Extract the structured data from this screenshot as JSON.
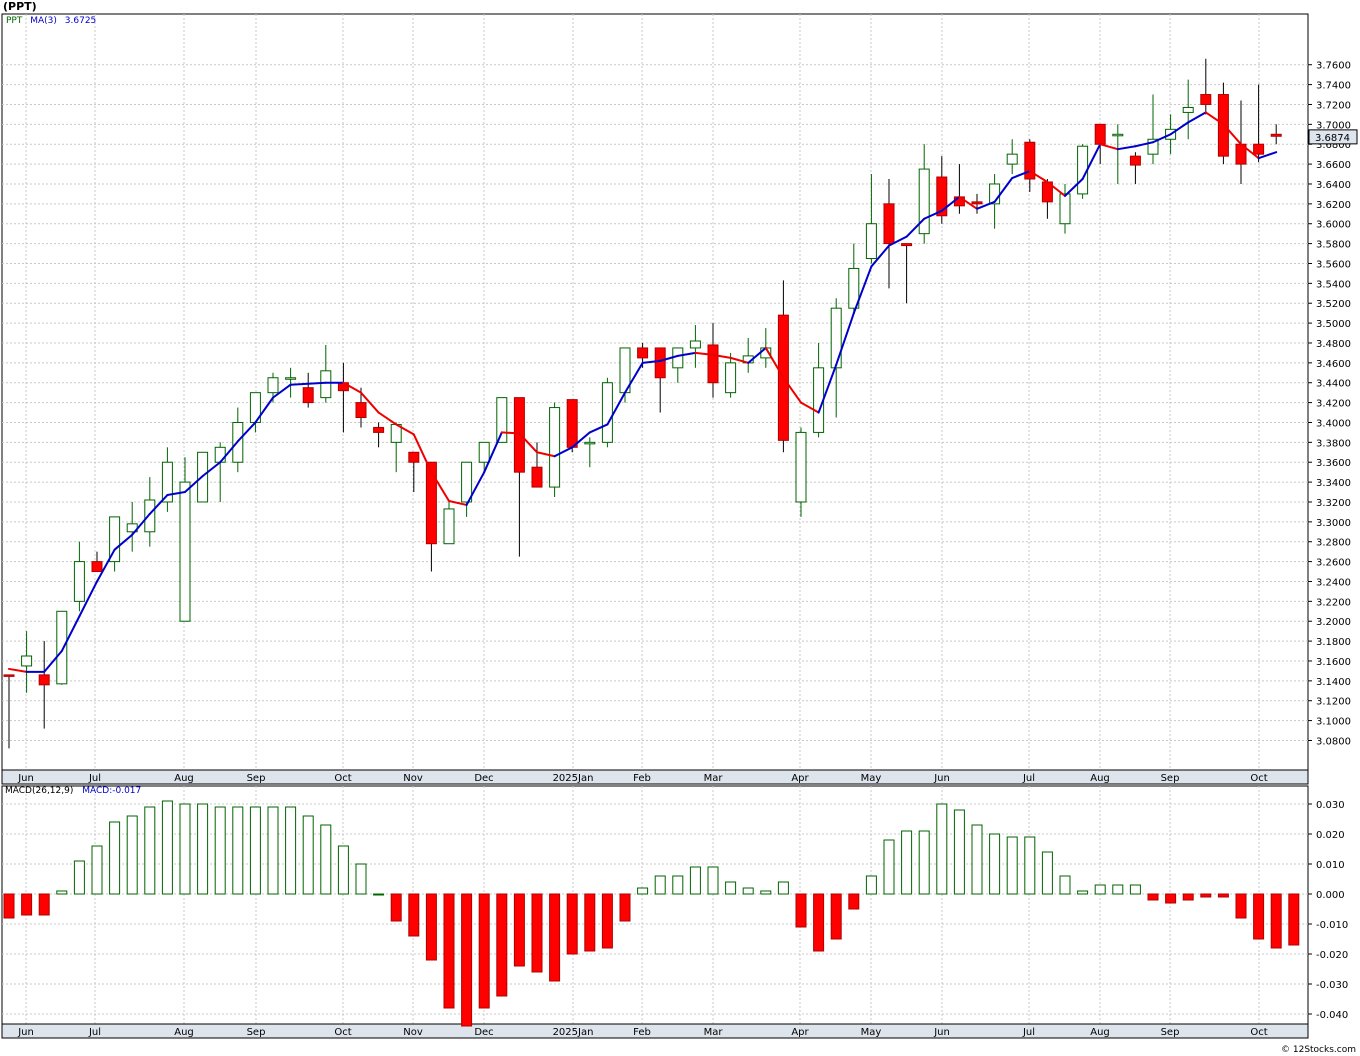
{
  "title": "(PPT)",
  "legend": {
    "symbol": "PPT",
    "ma_label": "MA(3)",
    "ma_value": "3.6725",
    "macd_label": "MACD(26,12,9)",
    "macd_value": "MACD:-0.017"
  },
  "last_price_label": "3.6874",
  "credit": "© 12Stocks.com",
  "colors": {
    "up": "#006400",
    "down": "#ff0000",
    "ma_up": "#0000cc",
    "ma_down": "#ee0000",
    "grid": "#c8c8c8",
    "axis_band": "#dde4ec"
  },
  "chart_data": [
    {
      "type": "candlestick",
      "title": "(PPT)",
      "x_labels": [
        "Jun",
        "Jul",
        "Aug",
        "Sep",
        "Oct",
        "Nov",
        "Dec",
        "2025Jan",
        "Feb",
        "Mar",
        "Apr",
        "May",
        "Jun",
        "Jul",
        "Aug",
        "Sep",
        "Oct"
      ],
      "y_ticks": [
        "3.0800",
        "3.1000",
        "3.1200",
        "3.1400",
        "3.1600",
        "3.1800",
        "3.2000",
        "3.2200",
        "3.2400",
        "3.2600",
        "3.2800",
        "3.3000",
        "3.3200",
        "3.3400",
        "3.3600",
        "3.3800",
        "3.4000",
        "3.4200",
        "3.4400",
        "3.4600",
        "3.4800",
        "3.5000",
        "3.5200",
        "3.5400",
        "3.5600",
        "3.5800",
        "3.6000",
        "3.6200",
        "3.6400",
        "3.6600",
        "3.6800",
        "3.7000",
        "3.7200",
        "3.7400",
        "3.7600"
      ],
      "ylim": [
        3.072,
        3.78
      ],
      "ohlc": [
        [
          3.146,
          3.146,
          3.072,
          3.145
        ],
        [
          3.155,
          3.19,
          3.128,
          3.165
        ],
        [
          3.146,
          3.18,
          3.092,
          3.136
        ],
        [
          3.137,
          3.21,
          3.136,
          3.21
        ],
        [
          3.22,
          3.28,
          3.21,
          3.26
        ],
        [
          3.26,
          3.27,
          3.25,
          3.25
        ],
        [
          3.26,
          3.305,
          3.25,
          3.305
        ],
        [
          3.29,
          3.32,
          3.27,
          3.298
        ],
        [
          3.29,
          3.345,
          3.275,
          3.322
        ],
        [
          3.32,
          3.375,
          3.31,
          3.36
        ],
        [
          3.2,
          3.365,
          3.2,
          3.34
        ],
        [
          3.32,
          3.37,
          3.32,
          3.37
        ],
        [
          3.36,
          3.38,
          3.32,
          3.375
        ],
        [
          3.36,
          3.415,
          3.35,
          3.4
        ],
        [
          3.4,
          3.43,
          3.39,
          3.43
        ],
        [
          3.43,
          3.45,
          3.42,
          3.445
        ],
        [
          3.445,
          3.455,
          3.425,
          3.445
        ],
        [
          3.435,
          3.45,
          3.415,
          3.42
        ],
        [
          3.425,
          3.478,
          3.42,
          3.452
        ],
        [
          3.44,
          3.46,
          3.39,
          3.432
        ],
        [
          3.42,
          3.435,
          3.395,
          3.405
        ],
        [
          3.395,
          3.4,
          3.375,
          3.39
        ],
        [
          3.38,
          3.4,
          3.35,
          3.398
        ],
        [
          3.37,
          3.37,
          3.33,
          3.36
        ],
        [
          3.36,
          3.36,
          3.25,
          3.278
        ],
        [
          3.278,
          3.32,
          3.278,
          3.313
        ],
        [
          3.32,
          3.36,
          3.305,
          3.36
        ],
        [
          3.36,
          3.38,
          3.35,
          3.38
        ],
        [
          3.38,
          3.425,
          3.38,
          3.425
        ],
        [
          3.425,
          3.425,
          3.265,
          3.35
        ],
        [
          3.355,
          3.38,
          3.335,
          3.335
        ],
        [
          3.335,
          3.42,
          3.325,
          3.415
        ],
        [
          3.423,
          3.423,
          3.37,
          3.375
        ],
        [
          3.38,
          3.385,
          3.355,
          3.38
        ],
        [
          3.38,
          3.445,
          3.375,
          3.44
        ],
        [
          3.43,
          3.475,
          3.42,
          3.475
        ],
        [
          3.475,
          3.48,
          3.455,
          3.465
        ],
        [
          3.475,
          3.475,
          3.41,
          3.445
        ],
        [
          3.455,
          3.475,
          3.44,
          3.475
        ],
        [
          3.475,
          3.498,
          3.455,
          3.482
        ],
        [
          3.478,
          3.5,
          3.425,
          3.44
        ],
        [
          3.43,
          3.47,
          3.425,
          3.46
        ],
        [
          3.46,
          3.485,
          3.45,
          3.467
        ],
        [
          3.465,
          3.495,
          3.455,
          3.475
        ],
        [
          3.508,
          3.543,
          3.37,
          3.382
        ],
        [
          3.32,
          3.395,
          3.305,
          3.39
        ],
        [
          3.39,
          3.48,
          3.385,
          3.455
        ],
        [
          3.455,
          3.525,
          3.405,
          3.515
        ],
        [
          3.515,
          3.58,
          3.51,
          3.555
        ],
        [
          3.565,
          3.65,
          3.56,
          3.6
        ],
        [
          3.62,
          3.645,
          3.535,
          3.58
        ],
        [
          3.58,
          3.58,
          3.52,
          3.578
        ],
        [
          3.59,
          3.68,
          3.58,
          3.655
        ],
        [
          3.647,
          3.668,
          3.6,
          3.608
        ],
        [
          3.627,
          3.66,
          3.61,
          3.618
        ],
        [
          3.622,
          3.63,
          3.61,
          3.62
        ],
        [
          3.62,
          3.65,
          3.595,
          3.64
        ],
        [
          3.66,
          3.685,
          3.65,
          3.67
        ],
        [
          3.682,
          3.685,
          3.632,
          3.645
        ],
        [
          3.642,
          3.645,
          3.605,
          3.622
        ],
        [
          3.6,
          3.64,
          3.59,
          3.63
        ],
        [
          3.63,
          3.68,
          3.625,
          3.678
        ],
        [
          3.7,
          3.7,
          3.66,
          3.68
        ],
        [
          3.69,
          3.7,
          3.64,
          3.69
        ],
        [
          3.668,
          3.672,
          3.64,
          3.659
        ],
        [
          3.67,
          3.73,
          3.66,
          3.685
        ],
        [
          3.685,
          3.71,
          3.67,
          3.695
        ],
        [
          3.712,
          3.745,
          3.685,
          3.717
        ],
        [
          3.73,
          3.766,
          3.71,
          3.72
        ],
        [
          3.73,
          3.742,
          3.66,
          3.668
        ],
        [
          3.68,
          3.724,
          3.64,
          3.66
        ],
        [
          3.68,
          3.74,
          3.662,
          3.67
        ],
        [
          3.69,
          3.7,
          3.68,
          3.688
        ]
      ],
      "ma": [
        3.152,
        3.149,
        3.149,
        3.17,
        3.205,
        3.24,
        3.272,
        3.287,
        3.308,
        3.327,
        3.33,
        3.346,
        3.36,
        3.381,
        3.4,
        3.425,
        3.438,
        3.439,
        3.44,
        3.44,
        3.43,
        3.41,
        3.398,
        3.388,
        3.35,
        3.321,
        3.317,
        3.35,
        3.39,
        3.389,
        3.37,
        3.366,
        3.375,
        3.39,
        3.398,
        3.43,
        3.46,
        3.462,
        3.467,
        3.47,
        3.468,
        3.465,
        3.46,
        3.475,
        3.445,
        3.42,
        3.41,
        3.458,
        3.51,
        3.557,
        3.578,
        3.587,
        3.605,
        3.613,
        3.627,
        3.615,
        3.622,
        3.646,
        3.653,
        3.642,
        3.628,
        3.645,
        3.68,
        3.675,
        3.678,
        3.682,
        3.69,
        3.702,
        3.712,
        3.7,
        3.68,
        3.666,
        3.672
      ],
      "macd_hist": [
        -0.008,
        -0.007,
        -0.007,
        0.001,
        0.011,
        0.016,
        0.024,
        0.026,
        0.029,
        0.031,
        0.03,
        0.03,
        0.029,
        0.029,
        0.029,
        0.029,
        0.029,
        0.026,
        0.023,
        0.016,
        0.01,
        0,
        -0.009,
        -0.014,
        -0.022,
        -0.038,
        -0.044,
        -0.038,
        -0.034,
        -0.024,
        -0.026,
        -0.029,
        -0.02,
        -0.019,
        -0.018,
        -0.009,
        0.002,
        0.006,
        0.006,
        0.009,
        0.009,
        0.004,
        0.002,
        0.001,
        0.004,
        -0.011,
        -0.019,
        -0.015,
        -0.005,
        0.006,
        0.018,
        0.021,
        0.021,
        0.03,
        0.028,
        0.023,
        0.02,
        0.019,
        0.019,
        0.014,
        0.006,
        0.001,
        0.003,
        0.003,
        0.003,
        -0.002,
        -0.003,
        -0.002,
        -0.001,
        -0.001,
        -0.008,
        -0.015,
        -0.018,
        -0.017
      ],
      "macd_ticks": [
        "0.030",
        "0.020",
        "0.010",
        "0.000",
        "-0.010",
        "-0.020",
        "-0.030",
        "-0.040"
      ],
      "macd_ylim": [
        -0.044,
        0.032
      ]
    }
  ]
}
